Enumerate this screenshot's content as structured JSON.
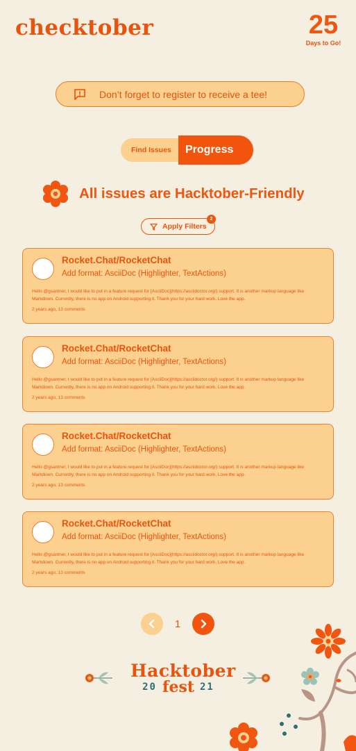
{
  "header": {
    "logo": "checktober",
    "days_number": "25",
    "days_label": "Days to Go!"
  },
  "banner": {
    "icon": "alert-icon",
    "text": "Don’t forget to register to receive a tee!"
  },
  "tabs": [
    {
      "label": "Find Issues",
      "active": false
    },
    {
      "label": "Progress",
      "active": true
    }
  ],
  "section": {
    "icon": "flower-icon",
    "title": "All issues are Hacktober-Friendly"
  },
  "filter": {
    "icon": "filter-icon",
    "label": "Apply Filters",
    "badge": "2"
  },
  "issues": [
    {
      "repo": "Rocket.Chat/RocketChat",
      "title": "Add format: AsciiDoc (Highlighter, TextActions)",
      "body": "Hello @gsantner, I would like to put in a feature request for [AsciiDoc](https://asciidoctor.org/) support. It is another markup language like Markdown. Currently, there is no app on Android supporting it. Thank you for your hard work. Love the app.",
      "meta": "2 years ago, 13 comments"
    },
    {
      "repo": "Rocket.Chat/RocketChat",
      "title": "Add format: AsciiDoc (Highlighter, TextActions)",
      "body": "Hello @gsantner, I would like to put in a feature request for [AsciiDoc](https://asciidoctor.org/) support. It is another markup language like Markdown. Currently, there is no app on Android supporting it. Thank you for your hard work. Love the app.",
      "meta": "2 years ago, 13 comments"
    },
    {
      "repo": "Rocket.Chat/RocketChat",
      "title": "Add format: AsciiDoc (Highlighter, TextActions)",
      "body": "Hello @gsantner, I would like to put in a feature request for [AsciiDoc](https://asciidoctor.org/) support. It is another markup language like Markdown. Currently, there is no app on Android supporting it. Thank you for your hard work. Love the app.",
      "meta": "2 years ago, 13 comments"
    },
    {
      "repo": "Rocket.Chat/RocketChat",
      "title": "Add format: AsciiDoc (Highlighter, TextActions)",
      "body": "Hello @gsantner, I would like to put in a feature request for [AsciiDoc](https://asciidoctor.org/) support. It is another markup language like Markdown. Currently, there is no app on Android supporting it. Thank you for your hard work. Love the app.",
      "meta": "2 years ago, 13 comments"
    }
  ],
  "pagination": {
    "current_page": "1",
    "prev_icon": "chevron-left-icon",
    "next_icon": "chevron-right-icon"
  },
  "footer": {
    "logo_line1": "Hacktober",
    "logo_line2": "fest",
    "year_left": "20",
    "year_right": "21"
  },
  "colors": {
    "background": "#f5efe1",
    "accent": "#f3540d",
    "card": "#fcd08f",
    "teal": "#2e6e74"
  }
}
